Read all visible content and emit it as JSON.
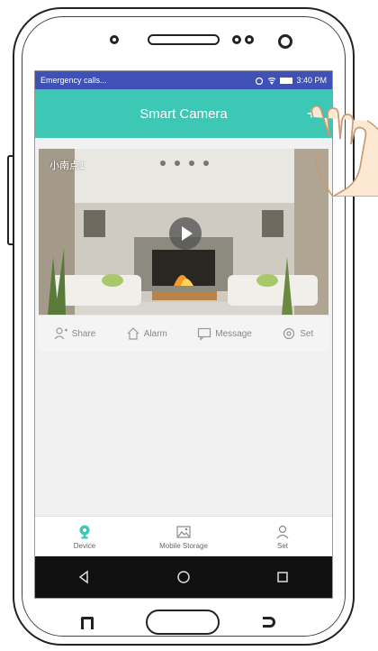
{
  "status_bar": {
    "carrier": "Emergency calls...",
    "time": "3:40 PM"
  },
  "app_bar": {
    "title": "Smart Camera",
    "add_label": "+"
  },
  "camera": {
    "name": "小南点1"
  },
  "actions": [
    {
      "label": "Share",
      "icon": "share-icon"
    },
    {
      "label": "Alarm",
      "icon": "home-alarm-icon"
    },
    {
      "label": "Message",
      "icon": "message-icon"
    },
    {
      "label": "Set",
      "icon": "gear-icon"
    }
  ],
  "bottom_nav": [
    {
      "label": "Device",
      "icon": "camera-device-icon",
      "active": true
    },
    {
      "label": "Mobile Storage",
      "icon": "gallery-icon",
      "active": false
    },
    {
      "label": "Set",
      "icon": "user-icon",
      "active": false
    }
  ],
  "colors": {
    "accent": "#3cc8b4",
    "status_bar": "#3f51b5"
  }
}
